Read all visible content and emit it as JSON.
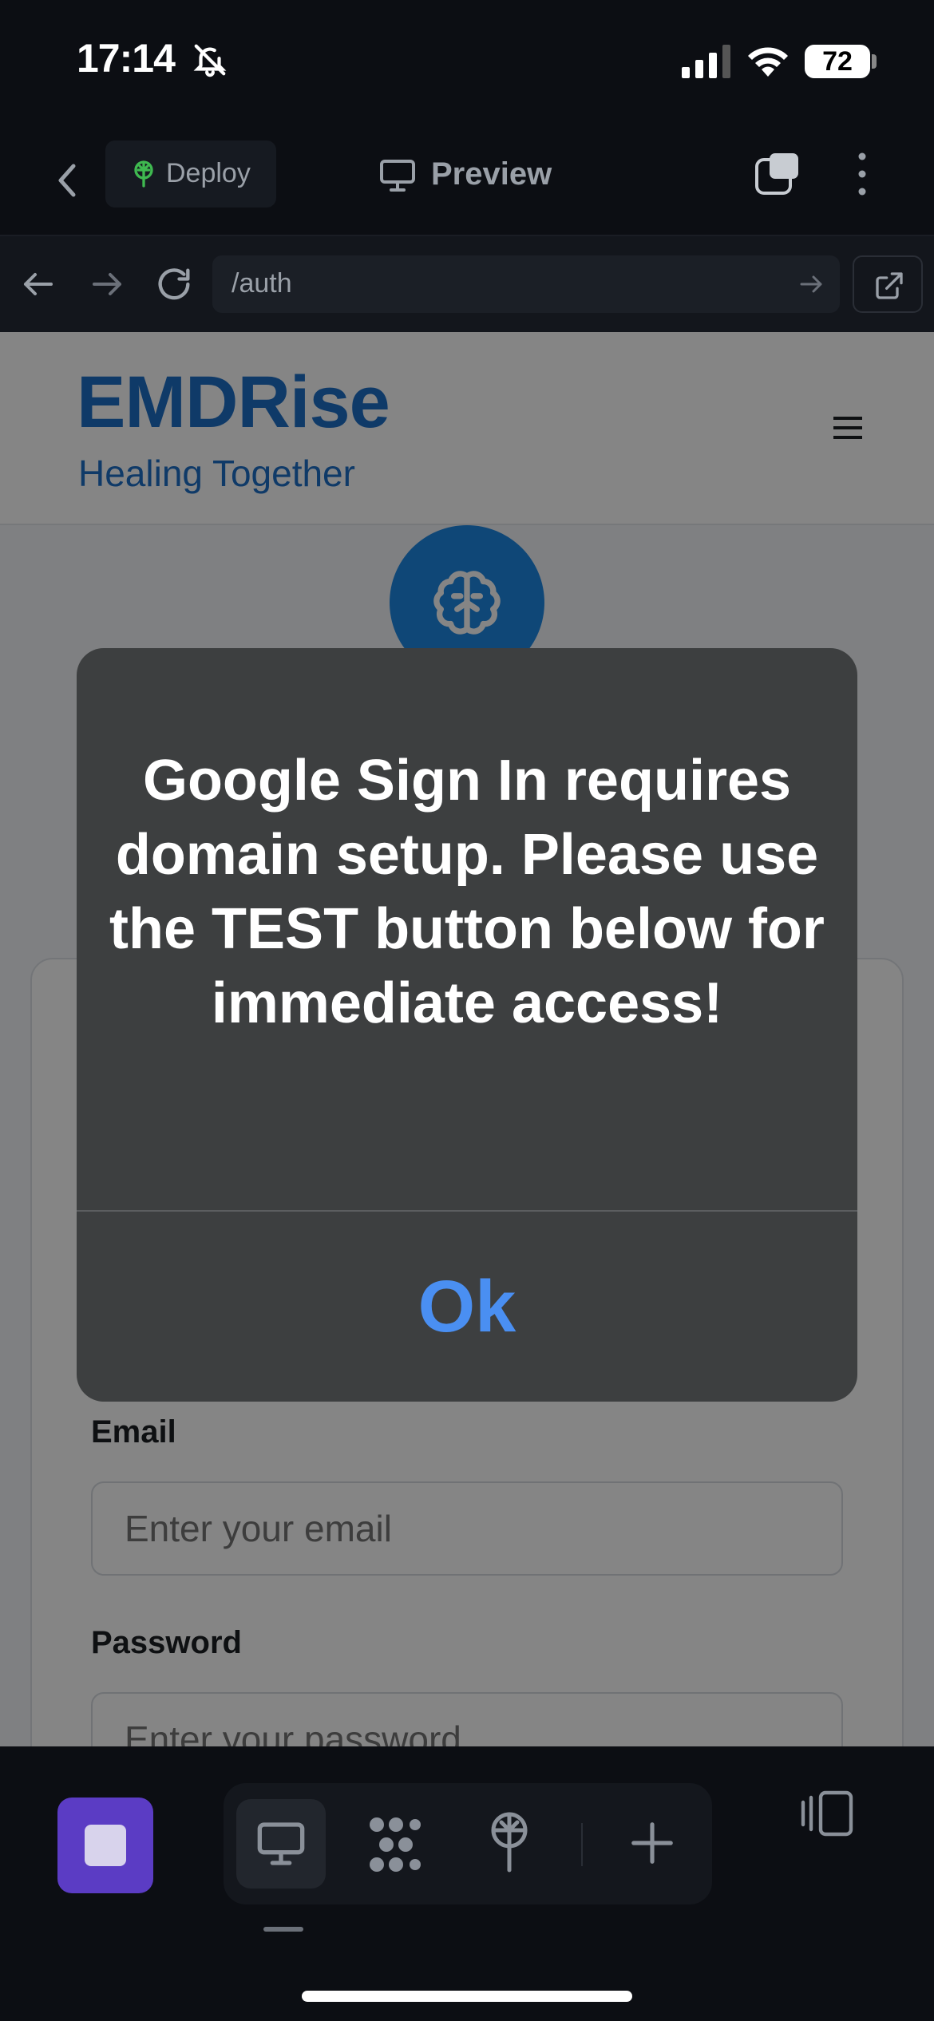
{
  "status_bar": {
    "time": "17:14",
    "battery": "72"
  },
  "toolbar": {
    "deploy_label": "Deploy",
    "preview_label": "Preview"
  },
  "browser": {
    "url": "/auth"
  },
  "site": {
    "brand": "EMDRise",
    "tagline": "Healing Together"
  },
  "form": {
    "email_label": "Email",
    "email_placeholder": "Enter your email",
    "password_label": "Password",
    "password_placeholder": "Enter your password"
  },
  "alert": {
    "message": "Google Sign In requires domain setup. Please use the TEST button below for immediate access!",
    "ok_label": "Ok"
  },
  "colors": {
    "brand": "#1e6fc8",
    "accent": "#5b3cc4",
    "alert_button": "#4a8ff2"
  },
  "icons": [
    "bell-muted-icon",
    "signal-icon",
    "wifi-icon",
    "chevron-left-icon",
    "deploy-tree-icon",
    "monitor-icon",
    "tabs-icon",
    "more-vertical-icon",
    "arrow-left-icon",
    "arrow-right-icon",
    "reload-icon",
    "external-link-icon",
    "hamburger-icon",
    "brain-icon",
    "stop-icon",
    "grid-icon",
    "plus-icon",
    "panel-icon"
  ]
}
